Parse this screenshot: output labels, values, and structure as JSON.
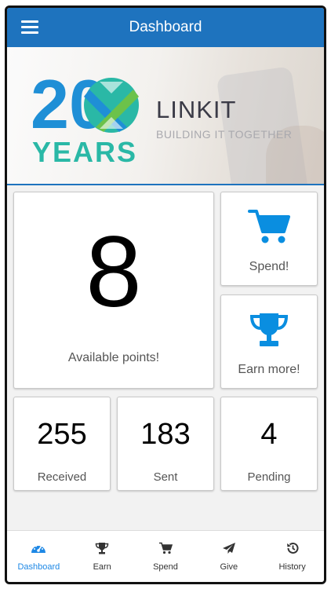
{
  "header": {
    "title": "Dashboard",
    "menu_icon": "hamburger-menu-icon"
  },
  "banner": {
    "logo_number": "20",
    "logo_word": "YEARS",
    "brand_name": "LINKIT",
    "brand_tagline": "BUILDING IT TOGETHER",
    "colors": {
      "blue": "#1f8fd6",
      "teal": "#2ab8a6",
      "green": "#6cc24a"
    }
  },
  "points": {
    "value": "8",
    "label": "Available points!"
  },
  "actions": {
    "spend": {
      "label": "Spend!",
      "icon": "shopping-cart-icon"
    },
    "earn": {
      "label": "Earn more!",
      "icon": "trophy-icon"
    }
  },
  "stats": {
    "received": {
      "value": "255",
      "label": "Received"
    },
    "sent": {
      "value": "183",
      "label": "Sent"
    },
    "pending": {
      "value": "4",
      "label": "Pending"
    }
  },
  "nav": {
    "active": "Dashboard",
    "items": [
      {
        "label": "Dashboard",
        "icon": "dashboard-gauge-icon"
      },
      {
        "label": "Earn",
        "icon": "trophy-icon"
      },
      {
        "label": "Spend",
        "icon": "shopping-cart-icon"
      },
      {
        "label": "Give",
        "icon": "paper-plane-icon"
      },
      {
        "label": "History",
        "icon": "history-icon"
      }
    ]
  },
  "colors": {
    "primary": "#1e73be",
    "accent": "#0a8ee0",
    "active_nav": "#1e88e5"
  }
}
